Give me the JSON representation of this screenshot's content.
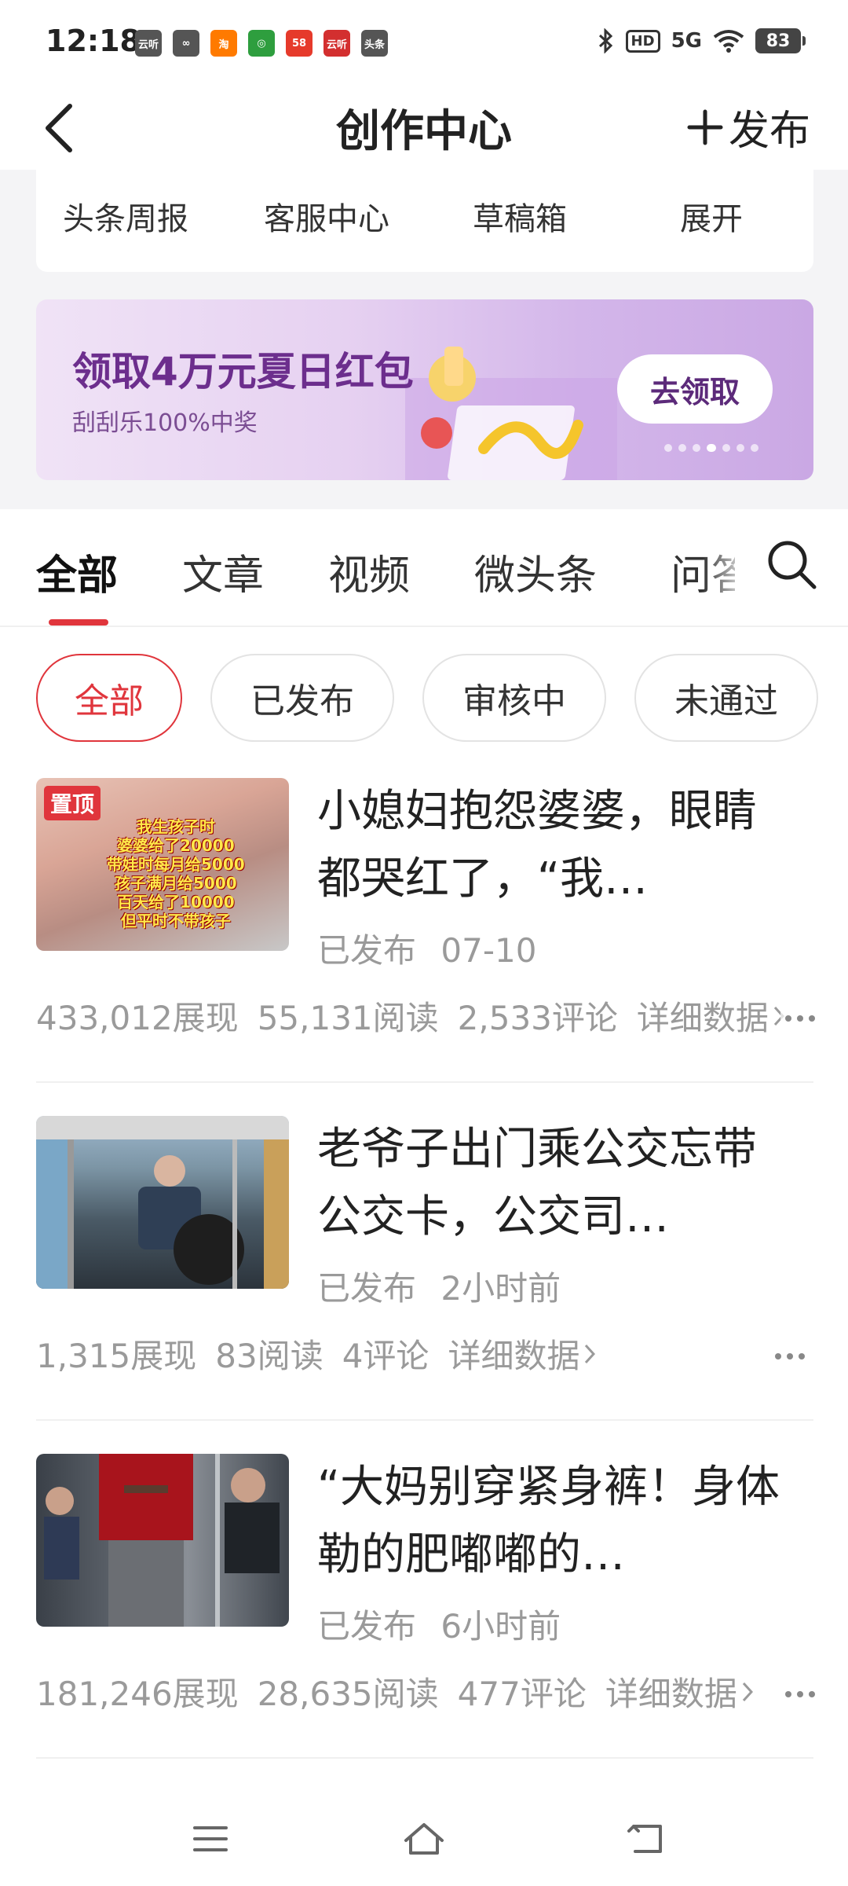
{
  "status_bar": {
    "time": "12:18",
    "notification_icons": [
      {
        "name": "news-app-icon",
        "label": "云听",
        "color": "#555555"
      },
      {
        "name": "link-app-icon",
        "label": "∞",
        "color": "#555555"
      },
      {
        "name": "taobao-app-icon",
        "label": "淘",
        "color": "#ff7a00"
      },
      {
        "name": "green-app-icon",
        "label": "◎",
        "color": "#2e9e3e"
      },
      {
        "name": "58-app-icon",
        "label": "58",
        "color": "#e63a2b"
      },
      {
        "name": "red-app-icon",
        "label": "云听",
        "color": "#d32f2f"
      },
      {
        "name": "toutiao-app-icon",
        "label": "头条",
        "color": "#555555"
      }
    ],
    "hd": "HD",
    "signal": "5G",
    "battery": "83"
  },
  "header": {
    "title": "创作中心",
    "publish_label": "发布"
  },
  "quick_links": [
    "头条周报",
    "客服中心",
    "草稿箱",
    "展开"
  ],
  "banner": {
    "title": "领取4万元夏日红包",
    "subtitle": "刮刮乐100%中奖",
    "button_label": "去领取",
    "dot_count": 7,
    "active_dot": 4
  },
  "tabs": {
    "items": [
      "全部",
      "文章",
      "视频",
      "微头条"
    ],
    "partial_item": "问答",
    "active_index": 0
  },
  "filters": {
    "items": [
      "全部",
      "已发布",
      "审核中",
      "未通过"
    ],
    "active_index": 0
  },
  "articles": [
    {
      "pinned_label": "置顶",
      "thumb_text": "我生孩子时\n婆婆给了20000\n带娃时每月给5000\n孩子满月给5000\n百天给了10000\n但平时不带孩子",
      "title": "小媳妇抱怨婆婆，眼睛都哭红了，“我…",
      "status": "已发布",
      "time": "07-10",
      "impressions": "433,012展现",
      "reads": "55,131阅读",
      "comments": "2,533评论",
      "detail_label": "详细数据"
    },
    {
      "pinned_label": "",
      "thumb_text": "",
      "title": "老爷子出门乘公交忘带公交卡，公交司…",
      "status": "已发布",
      "time": "2小时前",
      "impressions": "1,315展现",
      "reads": "83阅读",
      "comments": "4评论",
      "detail_label": "详细数据"
    },
    {
      "pinned_label": "",
      "thumb_text": "",
      "title": "“大妈别穿紧身裤！身体勒的肥嘟嘟的…",
      "status": "已发布",
      "time": "6小时前",
      "impressions": "181,246展现",
      "reads": "28,635阅读",
      "comments": "477评论",
      "detail_label": "详细数据"
    }
  ],
  "colors": {
    "accent": "#e0353c",
    "banner_text": "#6c2e8d"
  }
}
